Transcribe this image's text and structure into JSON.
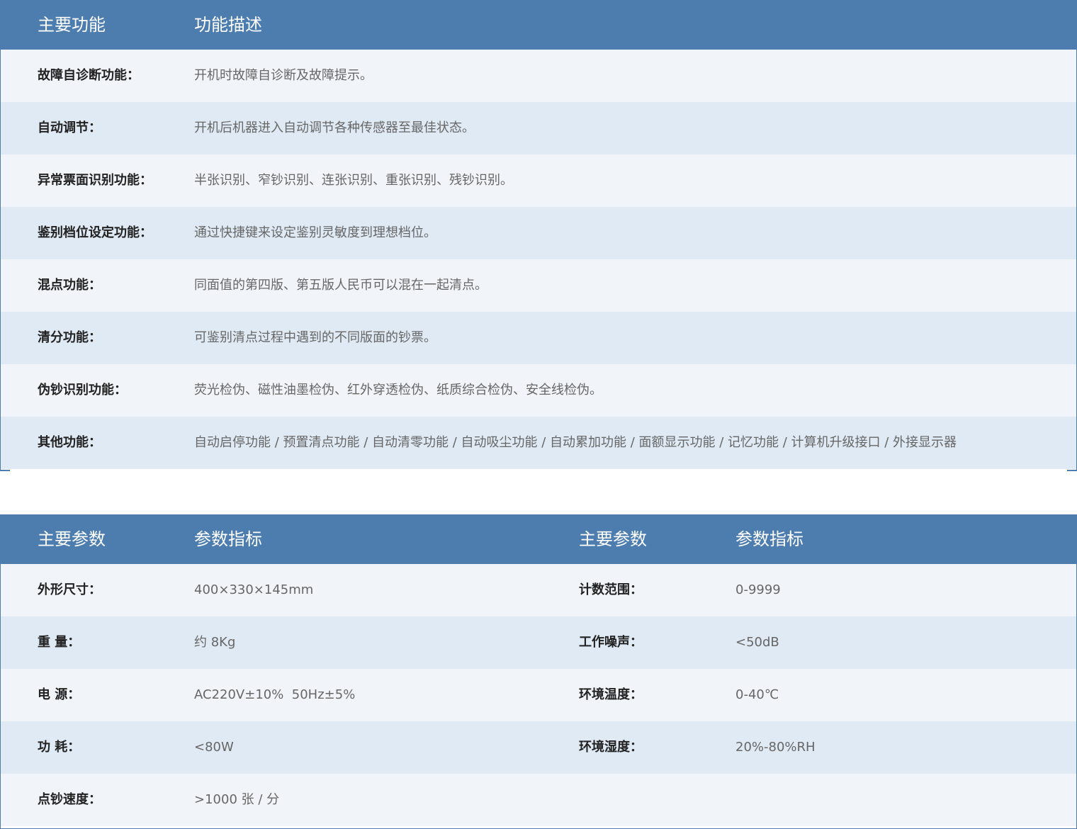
{
  "features": {
    "header": {
      "col1": "主要功能",
      "col2": "功能描述"
    },
    "rows": [
      {
        "name": "故障自诊断功能：",
        "desc": "开机时故障自诊断及故障提示。"
      },
      {
        "name": "自动调节：",
        "desc": "开机后机器进入自动调节各种传感器至最佳状态。"
      },
      {
        "name": "异常票面识别功能：",
        "desc": "半张识别、窄钞识别、连张识别、重张识别、残钞识别。"
      },
      {
        "name": "鉴别档位设定功能：",
        "desc": "通过快捷键来设定鉴别灵敏度到理想档位。"
      },
      {
        "name": "混点功能：",
        "desc": "同面值的第四版、第五版人民币可以混在一起清点。"
      },
      {
        "name": "清分功能：",
        "desc": "可鉴别清点过程中遇到的不同版面的钞票。"
      },
      {
        "name": "伪钞识别功能：",
        "desc": "荧光检伪、磁性油墨检伪、红外穿透检伪、纸质综合检伪、安全线检伪。"
      },
      {
        "name": "其他功能：",
        "desc": "自动启停功能 / 预置清点功能 / 自动清零功能 / 自动吸尘功能 / 自动累加功能 / 面额显示功能 / 记忆功能 / 计算机升级接口 / 外接显示器"
      }
    ]
  },
  "params": {
    "header": {
      "col1": "主要参数",
      "col2": "参数指标",
      "col3": "主要参数",
      "col4": "参数指标"
    },
    "rows": [
      {
        "k1": "外形尺寸：",
        "v1": "400×330×145mm",
        "k2": "计数范围：",
        "v2": "0-9999"
      },
      {
        "k1": "重 量：",
        "v1": "约 8Kg",
        "k2": "工作噪声：",
        "v2": "<50dB"
      },
      {
        "k1": "电 源：",
        "v1": "AC220V±10%  50Hz±5%",
        "k2": "环境温度：",
        "v2": "0-40℃"
      },
      {
        "k1": "功 耗：",
        "v1": "<80W",
        "k2": "环境湿度：",
        "v2": "20%-80%RH"
      },
      {
        "k1": "点钞速度：",
        "v1": ">1000 张 / 分",
        "k2": "",
        "v2": ""
      }
    ]
  },
  "colors": {
    "header_bg": "#4d7daf",
    "row_light": "#f1f5fa",
    "row_dark": "#e0eaf4",
    "label": "#222222",
    "value": "#666666"
  }
}
